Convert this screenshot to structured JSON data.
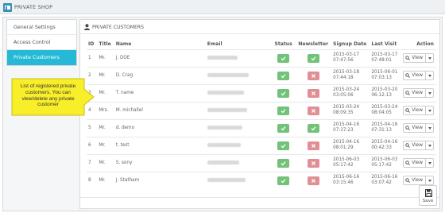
{
  "app": {
    "title": "PRIVATE SHOP",
    "logo_icon": "shop-logo-icon"
  },
  "sidebar": {
    "items": [
      {
        "label": "General Settings",
        "active": false
      },
      {
        "label": "Access Control",
        "active": false
      },
      {
        "label": "Private Customers",
        "active": true
      }
    ]
  },
  "panel": {
    "title": "PRIVATE CUSTOMERS",
    "icon": "user-icon",
    "columns": [
      "ID",
      "Title",
      "Name",
      "Email",
      "Status",
      "Newsletter",
      "Signup Date",
      "Last Visit",
      "Action"
    ],
    "rows": [
      {
        "id": "1",
        "title": "Mr.",
        "name": "J. DOE",
        "status": true,
        "newsletter": true,
        "signup_date": "2015-03-17",
        "signup_time": "07:47:56",
        "last_visit_date": "2015-03-17",
        "last_visit_time": "07:48:01"
      },
      {
        "id": "2",
        "title": "Mr.",
        "name": "D. Crag",
        "status": true,
        "newsletter": false,
        "signup_date": "2015-03-18",
        "signup_time": "07:44:18",
        "last_visit_date": "2015-06-01",
        "last_visit_time": "07:03:13"
      },
      {
        "id": "3",
        "title": "Mr.",
        "name": "T. name",
        "status": true,
        "newsletter": false,
        "signup_date": "2015-03-24",
        "signup_time": "03:05:06",
        "last_visit_date": "2015-03-20",
        "last_visit_time": "06:12:13"
      },
      {
        "id": "4",
        "title": "Mrs.",
        "name": "M. michallel",
        "status": true,
        "newsletter": false,
        "signup_date": "2015-03-24",
        "signup_time": "08:09:35",
        "last_visit_date": "2015-03-24",
        "last_visit_time": "08:04:05"
      },
      {
        "id": "5",
        "title": "Mr.",
        "name": "d. demo",
        "status": true,
        "newsletter": true,
        "signup_date": "2015-04-16",
        "signup_time": "07:37:23",
        "last_visit_date": "2015-04-16",
        "last_visit_time": "07:31:13"
      },
      {
        "id": "6",
        "title": "Mr.",
        "name": "t. test",
        "status": true,
        "newsletter": false,
        "signup_date": "2015-04-16",
        "signup_time": "08:01:29",
        "last_visit_date": "2015-04-16",
        "last_visit_time": "00:42:33"
      },
      {
        "id": "7",
        "title": "Mr.",
        "name": "S. sony",
        "status": true,
        "newsletter": false,
        "signup_date": "2015-06-03",
        "signup_time": "05:17:42",
        "last_visit_date": "2015-06-03",
        "last_visit_time": "05:17:42"
      },
      {
        "id": "8",
        "title": "Mr.",
        "name": "J. Statham",
        "status": true,
        "newsletter": false,
        "signup_date": "2015-06-16",
        "signup_time": "03:15:46",
        "last_visit_date": "2015-06-16",
        "last_visit_time": "03:07:42"
      }
    ],
    "action": {
      "view_label": "View",
      "view_icon": "search-icon",
      "caret_icon": "caret-down-icon"
    },
    "save_label": "Save",
    "save_icon": "floppy-disk-icon"
  },
  "callout": {
    "text": "List of registered private customers. You can view/delete any private customer"
  },
  "colors": {
    "accent": "#25b9d7",
    "enabled": "#72c279",
    "disabled": "#e08f95",
    "callout": "#f9ee2a"
  }
}
